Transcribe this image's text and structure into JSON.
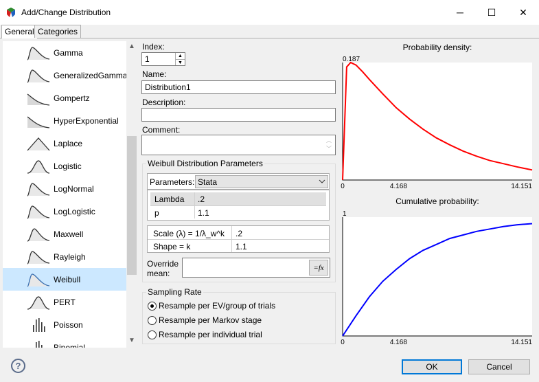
{
  "window": {
    "title": "Add/Change Distribution",
    "minimize": "─",
    "maximize": "☐",
    "close": "✕"
  },
  "tabs": [
    {
      "label": "General"
    },
    {
      "label": "Categories"
    }
  ],
  "distributions": [
    {
      "label": "Gamma",
      "icon": "gamma-curve-icon"
    },
    {
      "label": "GeneralizedGamma",
      "icon": "generalized-gamma-curve-icon"
    },
    {
      "label": "Gompertz",
      "icon": "gompertz-curve-icon"
    },
    {
      "label": "HyperExponential",
      "icon": "hyperexponential-curve-icon"
    },
    {
      "label": "Laplace",
      "icon": "laplace-curve-icon"
    },
    {
      "label": "Logistic",
      "icon": "logistic-curve-icon"
    },
    {
      "label": "LogNormal",
      "icon": "lognormal-curve-icon"
    },
    {
      "label": "LogLogistic",
      "icon": "loglogistic-curve-icon"
    },
    {
      "label": "Maxwell",
      "icon": "maxwell-curve-icon"
    },
    {
      "label": "Rayleigh",
      "icon": "rayleigh-curve-icon"
    },
    {
      "label": "Weibull",
      "icon": "weibull-curve-icon",
      "selected": true
    },
    {
      "label": "PERT",
      "icon": "pert-curve-icon"
    },
    {
      "label": "Poisson",
      "icon": "poisson-bars-icon"
    },
    {
      "label": "Binomial",
      "icon": "binomial-bars-icon"
    }
  ],
  "form": {
    "index_label": "Index:",
    "index_value": "1",
    "name_label": "Name:",
    "name_value": "Distribution1",
    "description_label": "Description:",
    "description_value": "",
    "comment_label": "Comment:",
    "comment_value": ""
  },
  "params": {
    "group_title": "Weibull Distribution Parameters",
    "parameters_label": "Parameters:",
    "parameters_value": "Stata",
    "rows": [
      {
        "name": "Lambda",
        "value": ".2"
      },
      {
        "name": "p",
        "value": "1.1"
      }
    ],
    "derived": [
      {
        "name": "Scale (λ) = 1/λ_w^k",
        "value": ".2"
      },
      {
        "name": "Shape = k",
        "value": "1.1"
      }
    ],
    "override_label_1": "Override",
    "override_label_2": "mean:",
    "override_value": "",
    "fx_label": "=fx"
  },
  "sampling": {
    "title": "Sampling Rate",
    "options": [
      {
        "label": "Resample per EV/group of trials",
        "checked": true
      },
      {
        "label": "Resample per Markov stage",
        "checked": false
      },
      {
        "label": "Resample per individual trial",
        "checked": false
      }
    ]
  },
  "chart_data": [
    {
      "type": "line",
      "title": "Probability density:",
      "x_ticks": [
        "0",
        "4.168",
        "14.151"
      ],
      "xlim": [
        0,
        14.151
      ],
      "y_label_top": "0.187",
      "ylim": [
        0,
        0.187
      ],
      "color": "#ff0000",
      "x": [
        0,
        0.3,
        0.6,
        1,
        1.5,
        2,
        3,
        4,
        5,
        6,
        7,
        8,
        9,
        10,
        11,
        12,
        13,
        14.151
      ],
      "y": [
        0,
        0.18,
        0.187,
        0.183,
        0.172,
        0.16,
        0.137,
        0.115,
        0.097,
        0.081,
        0.067,
        0.056,
        0.046,
        0.038,
        0.031,
        0.026,
        0.021,
        0.016
      ]
    },
    {
      "type": "line",
      "title": "Cumulative probability:",
      "x_ticks": [
        "0",
        "4.168",
        "14.151"
      ],
      "xlim": [
        0,
        14.151
      ],
      "y_label_top": "1",
      "ylim": [
        0,
        1
      ],
      "color": "#0000ff",
      "x": [
        0,
        1,
        2,
        3,
        4,
        5,
        6,
        7,
        8,
        9,
        10,
        11,
        12,
        13,
        14.151
      ],
      "y": [
        0,
        0.17,
        0.33,
        0.46,
        0.56,
        0.65,
        0.72,
        0.77,
        0.82,
        0.85,
        0.88,
        0.9,
        0.92,
        0.935,
        0.945
      ]
    }
  ],
  "footer": {
    "help": "?",
    "ok": "OK",
    "cancel": "Cancel"
  }
}
